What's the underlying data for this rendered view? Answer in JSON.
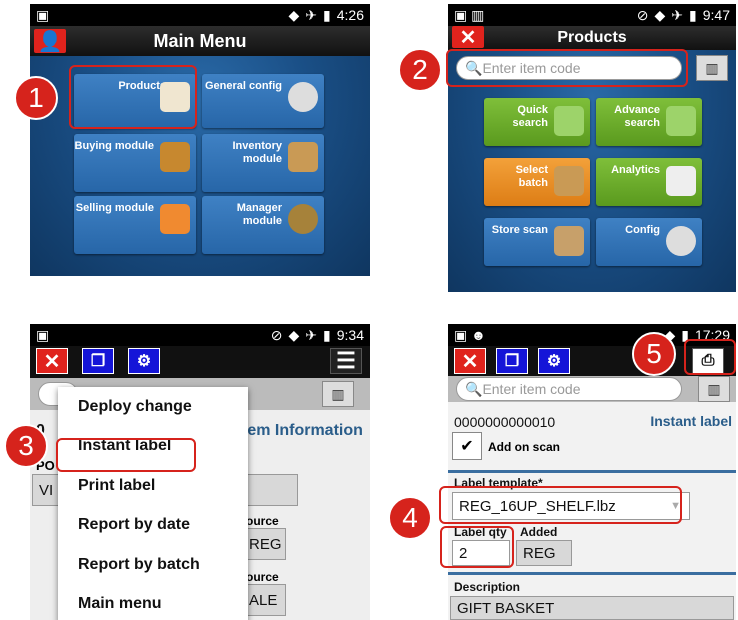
{
  "panel1": {
    "time": "4:26",
    "title": "Main Menu",
    "tiles": [
      "Products",
      "General config",
      "Buying module",
      "Inventory module",
      "Selling module",
      "Manager module"
    ]
  },
  "panel2": {
    "time": "9:47",
    "title": "Products",
    "close": "✕",
    "search_placeholder": "Enter item code",
    "tiles": [
      "Quick search",
      "Advance search",
      "Select batch",
      "Analytics",
      "Store scan",
      "Config"
    ]
  },
  "panel3": {
    "time": "9:34",
    "menu": [
      "Deploy change",
      "Instant label",
      "Print label",
      "Report by date",
      "Report by batch",
      "Main menu"
    ],
    "behind": {
      "heading": "tem Information",
      "po": "PO",
      "vi": "VI",
      "source1": "ource",
      "reg": "REG",
      "source2": "ource",
      "ale": "ALE",
      "zero": "0"
    }
  },
  "panel4": {
    "time": "17:29",
    "search_placeholder": "Enter item code",
    "code": "0000000000010",
    "mode": "Instant label",
    "add_on_scan": "Add on scan",
    "label_template_label": "Label template*",
    "label_template_value": "REG_16UP_SHELF.lbz",
    "qty_label": "Label qty",
    "qty_value": "2",
    "added_label": "Added",
    "added_value": "REG",
    "description_label": "Description",
    "description_value": "GIFT BASKET"
  },
  "callouts": [
    "1",
    "2",
    "3",
    "4",
    "5"
  ]
}
